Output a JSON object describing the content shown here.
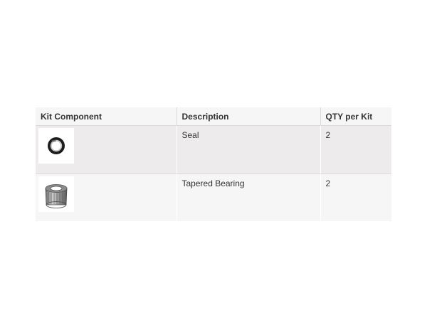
{
  "table": {
    "headers": {
      "component": "Kit Component",
      "description": "Description",
      "qty": "QTY per Kit"
    },
    "rows": [
      {
        "image_icon": "seal-icon",
        "description": "Seal",
        "qty": "2"
      },
      {
        "image_icon": "tapered-bearing-icon",
        "description": "Tapered Bearing",
        "qty": "2"
      }
    ]
  },
  "colors": {
    "header_bg": "#f7f6f6",
    "row_shaded_bg": "#edebeb",
    "row_light_bg": "#f7f6f6",
    "text": "#333333",
    "divider": "#dcdadb"
  }
}
